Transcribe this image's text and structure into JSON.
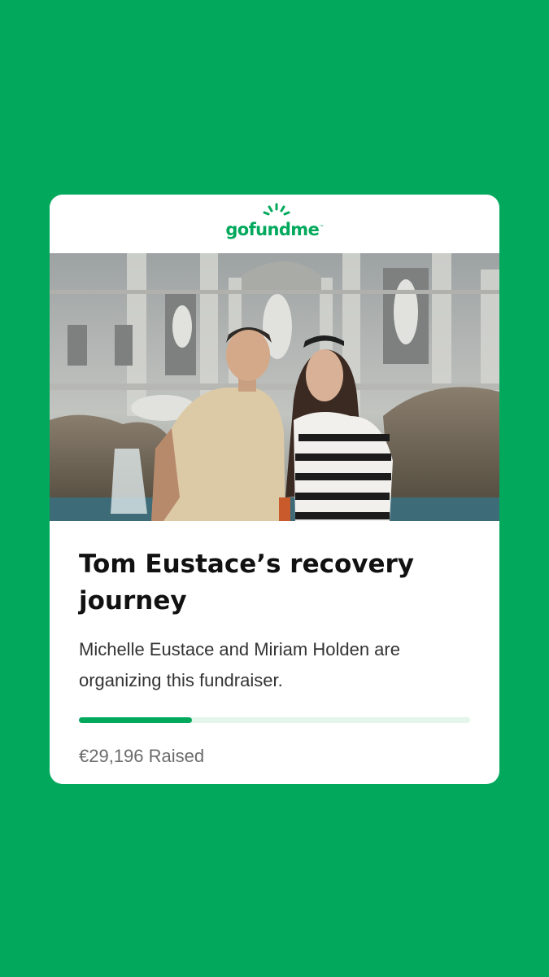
{
  "brand": {
    "logo_text": "gofundme",
    "logo_icon": "sun-rays-icon"
  },
  "colors": {
    "brand_green": "#02a95c",
    "progress_track": "#e4f5ec",
    "card_bg": "#ffffff"
  },
  "fundraiser": {
    "title": "Tom Eustace’s recovery journey",
    "organizer_text": "Michelle Eustace and Miriam Holden are organizing this fundraiser.",
    "progress_fraction": 0.29,
    "amount_raised": "€29,196 Raised"
  }
}
